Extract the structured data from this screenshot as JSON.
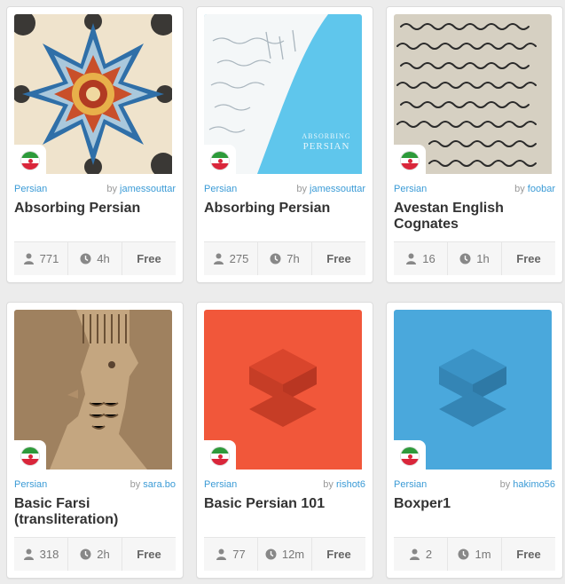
{
  "courses": [
    {
      "language": "Persian",
      "by_prefix": "by",
      "author": "jamessouttar",
      "title": "Absorbing Persian",
      "learners": "771",
      "duration": "4h",
      "price": "Free",
      "cover": "mosaic"
    },
    {
      "language": "Persian",
      "by_prefix": "by",
      "author": "jamessouttar",
      "title": "Absorbing Persian",
      "learners": "275",
      "duration": "7h",
      "price": "Free",
      "cover": "book",
      "cover_text_1": "ABSORBING",
      "cover_text_2": "PERSIAN"
    },
    {
      "language": "Persian",
      "by_prefix": "by",
      "author": "foobar",
      "title": "Avestan English Cognates",
      "learners": "16",
      "duration": "1h",
      "price": "Free",
      "cover": "manuscript"
    },
    {
      "language": "Persian",
      "by_prefix": "by",
      "author": "sara.bo",
      "title": "Basic Farsi (transliteration)",
      "learners": "318",
      "duration": "2h",
      "price": "Free",
      "cover": "relief"
    },
    {
      "language": "Persian",
      "by_prefix": "by",
      "author": "rishot6",
      "title": "Basic Persian 101",
      "learners": "77",
      "duration": "12m",
      "price": "Free",
      "cover": "logo-red"
    },
    {
      "language": "Persian",
      "by_prefix": "by",
      "author": "hakimo56",
      "title": "Boxper1",
      "learners": "2",
      "duration": "1m",
      "price": "Free",
      "cover": "logo-blue"
    }
  ],
  "icons": {
    "learners": "person-icon",
    "duration": "clock-icon",
    "flag": "iran-flag-icon"
  },
  "colors": {
    "accent": "#3b9bd6",
    "logo_red": "#f1573a",
    "logo_blue": "#4aa8dc",
    "flag_green": "#2d9a3a",
    "flag_red": "#d9263a"
  }
}
